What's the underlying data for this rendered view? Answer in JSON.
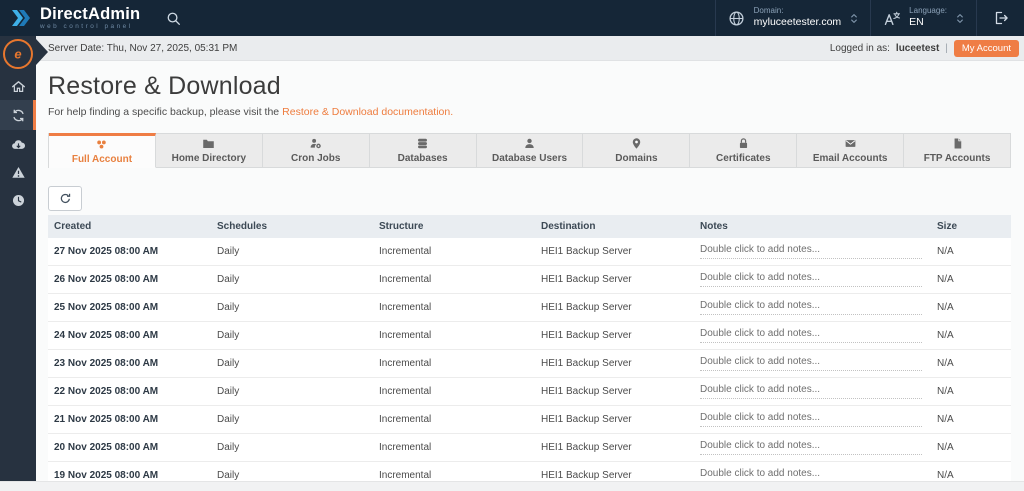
{
  "colors": {
    "accent_orange": "#ef7d45",
    "link_orange": "#ee7c3e",
    "topbar_bg": "#152637",
    "sidebar_bg": "#273240",
    "table_header_bg": "#e9edf1",
    "logo_ring_orange": "#e8772e"
  },
  "topbar": {
    "brand": {
      "name": "DirectAdmin",
      "tagline": "web control panel"
    },
    "search_icon": "search-icon",
    "domain": {
      "label": "Domain:",
      "value": "myluceetester.com"
    },
    "language": {
      "label": "Language:",
      "value": "EN"
    },
    "logout_icon": "logout-icon"
  },
  "statusbar": {
    "server_date": "Server Date: Thu, Nov 27, 2025, 05:31 PM",
    "logged_in_label": "Logged in as:",
    "username": "luceetest",
    "separator": "|",
    "my_account": "My Account"
  },
  "sidebar": {
    "items": [
      {
        "icon": "home-icon",
        "active": false
      },
      {
        "icon": "restore-sync-icon",
        "active": true
      },
      {
        "icon": "cloud-download-icon",
        "active": false
      },
      {
        "icon": "warning-icon",
        "active": false
      },
      {
        "icon": "clock-icon",
        "active": false
      }
    ]
  },
  "page": {
    "title": "Restore & Download",
    "help_prefix": "For help finding a specific backup, please visit the",
    "help_link": "Restore & Download documentation."
  },
  "tabs": [
    {
      "label": "Full Account",
      "icon": "full-account-icon",
      "active": true
    },
    {
      "label": "Home Directory",
      "icon": "folder-icon",
      "active": false
    },
    {
      "label": "Cron Jobs",
      "icon": "cron-user-icon",
      "active": false
    },
    {
      "label": "Databases",
      "icon": "database-icon",
      "active": false
    },
    {
      "label": "Database Users",
      "icon": "database-user-icon",
      "active": false
    },
    {
      "label": "Domains",
      "icon": "location-pin-icon",
      "active": false
    },
    {
      "label": "Certificates",
      "icon": "lock-icon",
      "active": false
    },
    {
      "label": "Email Accounts",
      "icon": "envelope-icon",
      "active": false
    },
    {
      "label": "FTP Accounts",
      "icon": "file-icon",
      "active": false
    }
  ],
  "toolbar": {
    "refresh_icon": "refresh-icon"
  },
  "table": {
    "columns": [
      "Created",
      "Schedules",
      "Structure",
      "Destination",
      "Notes",
      "Size"
    ],
    "rows": [
      {
        "created": "27 Nov 2025 08:00 AM",
        "schedules": "Daily",
        "structure": "Incremental",
        "destination": "HEI1 Backup Server",
        "notes": "Double click to add notes...",
        "size": "N/A"
      },
      {
        "created": "26 Nov 2025 08:00 AM",
        "schedules": "Daily",
        "structure": "Incremental",
        "destination": "HEI1 Backup Server",
        "notes": "Double click to add notes...",
        "size": "N/A"
      },
      {
        "created": "25 Nov 2025 08:00 AM",
        "schedules": "Daily",
        "structure": "Incremental",
        "destination": "HEI1 Backup Server",
        "notes": "Double click to add notes...",
        "size": "N/A"
      },
      {
        "created": "24 Nov 2025 08:00 AM",
        "schedules": "Daily",
        "structure": "Incremental",
        "destination": "HEI1 Backup Server",
        "notes": "Double click to add notes...",
        "size": "N/A"
      },
      {
        "created": "23 Nov 2025 08:00 AM",
        "schedules": "Daily",
        "structure": "Incremental",
        "destination": "HEI1 Backup Server",
        "notes": "Double click to add notes...",
        "size": "N/A"
      },
      {
        "created": "22 Nov 2025 08:00 AM",
        "schedules": "Daily",
        "structure": "Incremental",
        "destination": "HEI1 Backup Server",
        "notes": "Double click to add notes...",
        "size": "N/A"
      },
      {
        "created": "21 Nov 2025 08:00 AM",
        "schedules": "Daily",
        "structure": "Incremental",
        "destination": "HEI1 Backup Server",
        "notes": "Double click to add notes...",
        "size": "N/A"
      },
      {
        "created": "20 Nov 2025 08:00 AM",
        "schedules": "Daily",
        "structure": "Incremental",
        "destination": "HEI1 Backup Server",
        "notes": "Double click to add notes...",
        "size": "N/A"
      },
      {
        "created": "19 Nov 2025 08:00 AM",
        "schedules": "Daily",
        "structure": "Incremental",
        "destination": "HEI1 Backup Server",
        "notes": "Double click to add notes...",
        "size": "N/A"
      }
    ]
  }
}
